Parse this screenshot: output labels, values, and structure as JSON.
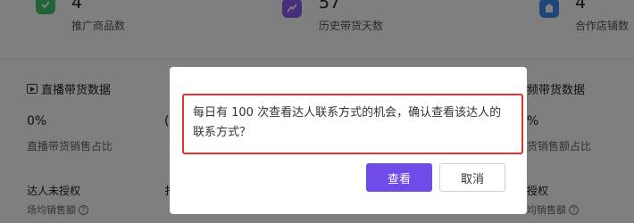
{
  "stats": [
    {
      "value": "4",
      "label": "推广商品数",
      "icon": "goods-icon",
      "color": "#42c46e"
    },
    {
      "value": "57",
      "label": "历史带货天数",
      "icon": "trend-icon",
      "color": "#8a5cf5"
    },
    {
      "value": "4",
      "label": "合作店铺数",
      "icon": "shop-icon",
      "color": "#3b8cf6"
    }
  ],
  "left_section": {
    "title": "直播带货数据",
    "metric_value": "0%",
    "metric_label": "直播带货销售占比",
    "auth_title": "达人未授权",
    "auth_sub": "场均销售额"
  },
  "right_section": {
    "title": "频带货数据",
    "metric_value": "%",
    "metric_label": "货销售额占比",
    "auth_title": "授权",
    "auth_sub": "均销售额"
  },
  "middle_fragments": {
    "metric_value": "(",
    "auth_title": "扌"
  },
  "modal": {
    "message": "每日有 100 次查看达人联系方式的机会，确认查看该达人的联系方式？",
    "confirm_label": "查看",
    "cancel_label": "取消",
    "accent": "#6f4be8",
    "highlight": "#e0352b"
  }
}
